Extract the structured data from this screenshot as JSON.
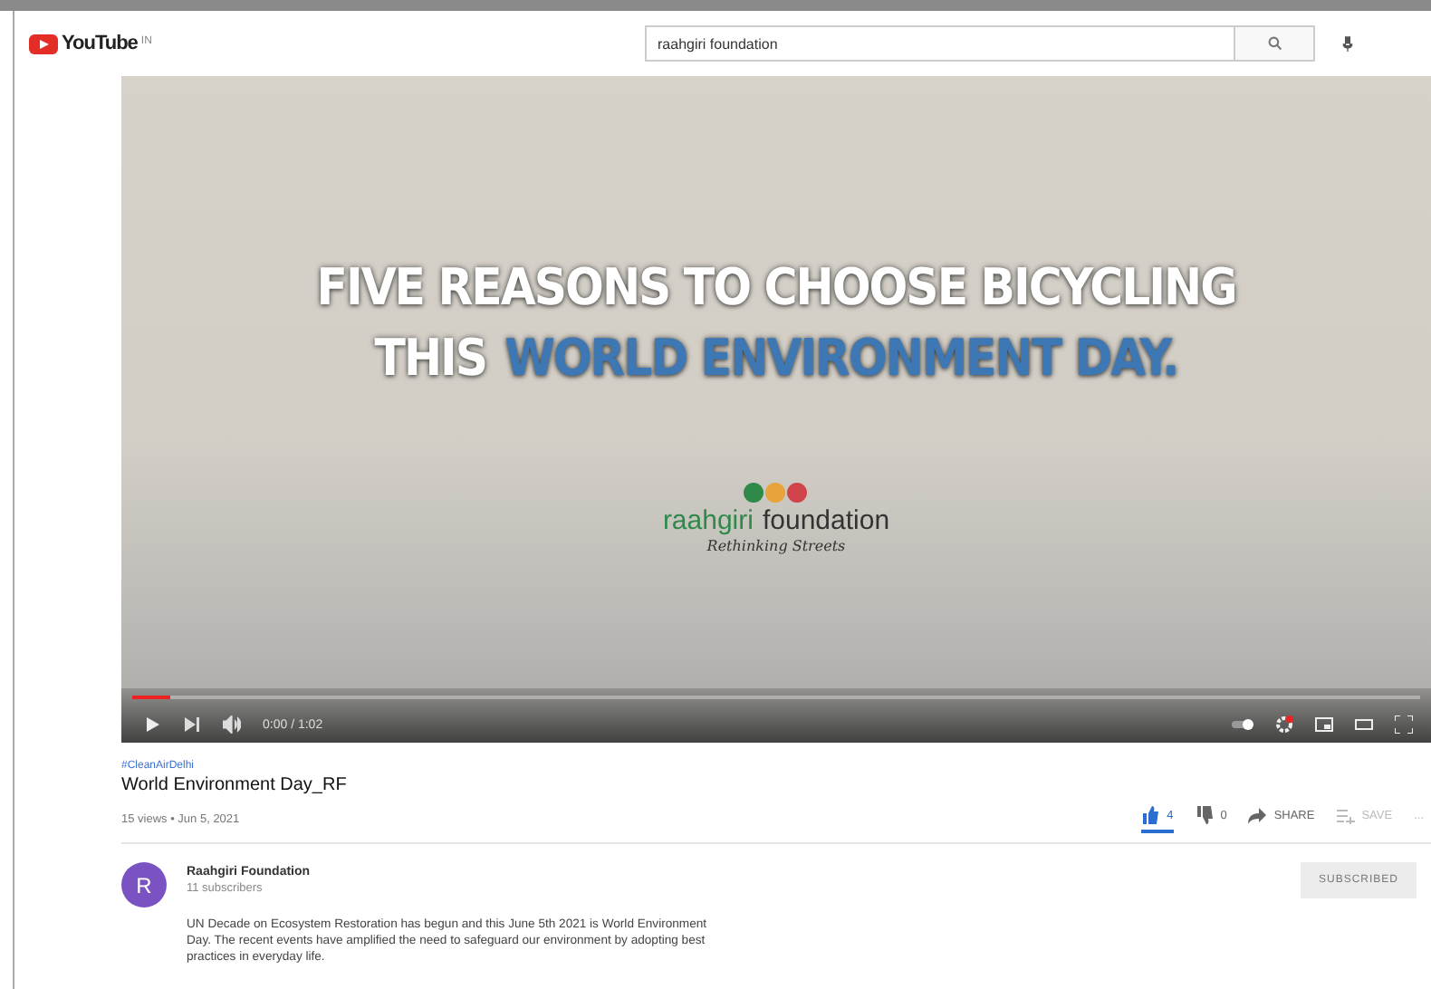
{
  "header": {
    "logo": "YouTube",
    "logo_sup": "IN",
    "search": {
      "value": "raahgiri foundation"
    }
  },
  "video": {
    "headline": [
      {
        "text": "FIVE REASONS TO CHOOSE BICYCLING",
        "kind": "plain"
      },
      {
        "text": "THIS",
        "kind": "plain"
      },
      {
        "text": "WORLD ENVIRONMENT DAY.",
        "kind": "accent"
      }
    ],
    "brand": {
      "name_a": "raahgiri",
      "name_b": "foundation",
      "tagline": "Rethinking Streets"
    },
    "progress": {
      "level": 0.03
    },
    "time": "0:00 / 1:02"
  },
  "info": {
    "hashtag": "#CleanAirDelhi",
    "title": "World Environment Day_RF",
    "meta": "15 views • Jun 5, 2021",
    "actions": [
      {
        "kind": "like",
        "label": "4",
        "selected": true
      },
      {
        "kind": "dislike",
        "label": "0",
        "selected": false
      },
      {
        "kind": "share",
        "label": "SHARE",
        "selected": false
      },
      {
        "kind": "save",
        "label": "SAVE",
        "selected": false
      },
      {
        "kind": "more",
        "label": "...",
        "selected": false
      }
    ]
  },
  "channel": {
    "initial": "R",
    "name": "Raahgiri Foundation",
    "subscribers": "11 subscribers",
    "subscribe": "SUBSCRIBED",
    "description": [
      "UN Decade on Ecosystem Restoration has begun and this June 5th 2021 is World Environment",
      "Day. The recent events have amplified the need to safeguard our environment by adopting best",
      "practices in everyday life."
    ]
  }
}
